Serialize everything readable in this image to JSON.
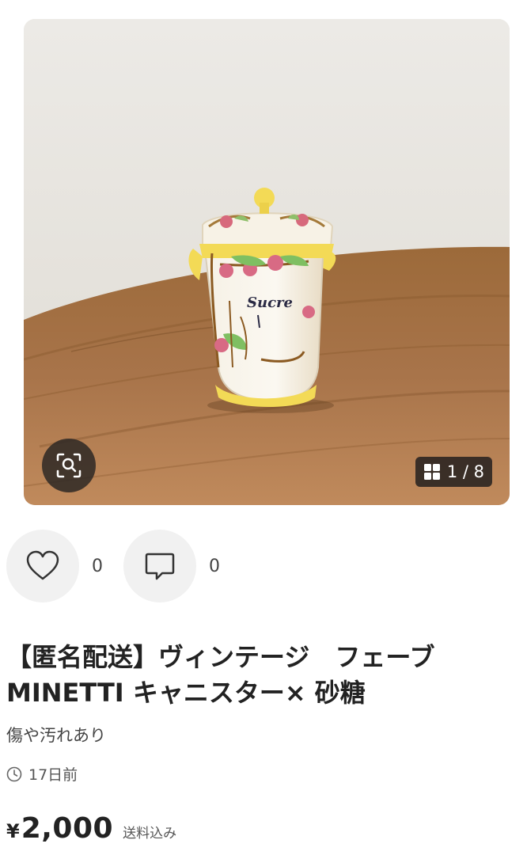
{
  "photo": {
    "alt": "",
    "label_on_item": "Sucre",
    "current_index": "1",
    "total": "8",
    "counter_text": "1 / 8"
  },
  "actions": {
    "like_count": "0",
    "comment_count": "0"
  },
  "item": {
    "title_line1": "【匿名配送】ヴィンテージ　フェーブ",
    "title_line2": "MINETTI キャニスター× 砂糖",
    "condition": "傷や汚れあり",
    "posted": "17日前",
    "currency_symbol": "¥",
    "price": "2,000",
    "shipping_note": "送料込み"
  },
  "icons": {
    "zoom": "image-search-icon",
    "counter": "grid-icon",
    "like": "heart-icon",
    "comment": "comment-icon",
    "time": "clock-icon"
  },
  "colors": {
    "text": "#222222",
    "button_bg": "#f1f1f1",
    "overlay": "#2d2824"
  }
}
